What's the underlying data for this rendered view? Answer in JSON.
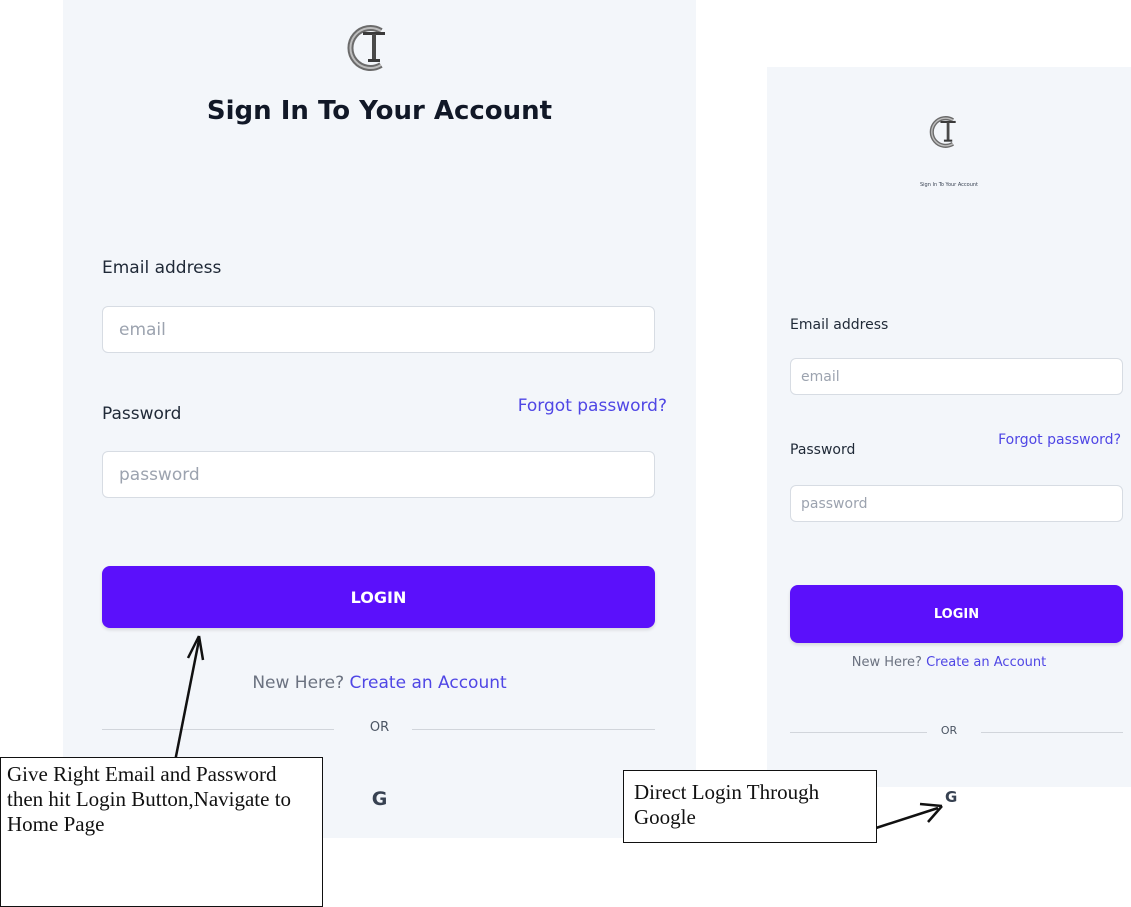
{
  "desktop": {
    "title": "Sign In To Your Account",
    "email_label": "Email address",
    "email_placeholder": "email",
    "password_label": "Password",
    "forgot_link": "Forgot password?",
    "password_placeholder": "password",
    "login_button": "LOGIN",
    "new_here_text": "New Here?",
    "create_account_link": "Create an Account",
    "or_text": "OR",
    "google_icon_text": "G"
  },
  "mobile": {
    "title": "Sign In To Your Account",
    "email_label": "Email address",
    "email_placeholder": "email",
    "password_label": "Password",
    "forgot_link": "Forgot password?",
    "password_placeholder": "password",
    "login_button": "LOGIN",
    "new_here_text": "New Here?",
    "create_account_link": "Create an Account",
    "or_text": "OR",
    "google_icon_text": "G"
  },
  "annotations": {
    "login_note": "Give Right Email and Password then hit Login Button,Navigate to Home Page",
    "google_note": "Direct Login Through Google"
  },
  "colors": {
    "panel_bg": "#f3f6fa",
    "primary": "#5b10fb",
    "link": "#4f46e5"
  },
  "icons": {
    "logo": "ct-monogram-logo",
    "google": "google-g-icon",
    "annotation_arrow": "arrow-icon"
  }
}
